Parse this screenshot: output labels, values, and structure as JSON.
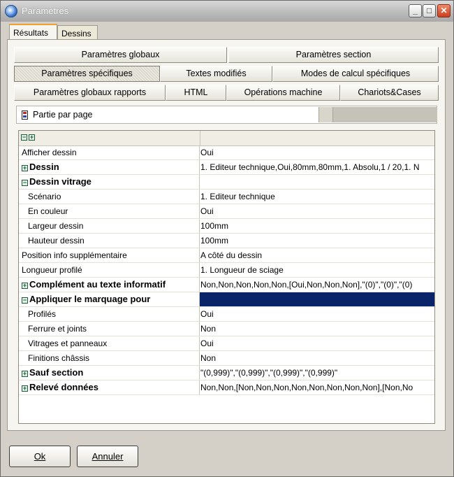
{
  "window": {
    "title": "Paramètres"
  },
  "outer_tabs": [
    {
      "label": "Résultats",
      "active": true
    },
    {
      "label": "Dessins",
      "active": false
    }
  ],
  "inner_tabs": {
    "row1": [
      "Paramètres globaux",
      "Paramètres section"
    ],
    "row2": [
      "Paramètres spécifiques",
      "Textes modifiés",
      "Modes de calcul spécifiques"
    ],
    "row3": [
      "Paramètres globaux rapports",
      "HTML",
      "Opérations machine",
      "Chariots&Cases"
    ],
    "selected": "Paramètres spécifiques"
  },
  "combo": {
    "value": "Partie par page"
  },
  "grid": {
    "rows": [
      {
        "name": "Afficher dessin",
        "value": "Oui",
        "level": 0,
        "bold": false,
        "toggle": ""
      },
      {
        "name": "Dessin",
        "value": "1. Editeur technique,Oui,80mm,80mm,1. Absolu,1 / 20,1. N",
        "level": 0,
        "bold": true,
        "toggle": "+"
      },
      {
        "name": "Dessin vitrage",
        "value": "",
        "level": 0,
        "bold": true,
        "toggle": "−"
      },
      {
        "name": "Scénario",
        "value": "1. Editeur technique",
        "level": 1,
        "bold": false,
        "toggle": ""
      },
      {
        "name": "En couleur",
        "value": "Oui",
        "level": 1,
        "bold": false,
        "toggle": ""
      },
      {
        "name": "Largeur dessin",
        "value": "100mm",
        "level": 1,
        "bold": false,
        "toggle": ""
      },
      {
        "name": "Hauteur dessin",
        "value": "100mm",
        "level": 1,
        "bold": false,
        "toggle": ""
      },
      {
        "name": "Position info supplémentaire",
        "value": "A côté du dessin",
        "level": 0,
        "bold": false,
        "toggle": ""
      },
      {
        "name": "Longueur profilé",
        "value": "1. Longueur de sciage",
        "level": 0,
        "bold": false,
        "toggle": ""
      },
      {
        "name": "Complément au texte informatif",
        "value": "Non,Non,Non,Non,Non,[Oui,Non,Non,Non],\"(0)\",\"(0)\",\"(0)",
        "level": 0,
        "bold": true,
        "toggle": "+"
      },
      {
        "name": "Appliquer le marquage pour",
        "value": "",
        "level": 0,
        "bold": true,
        "toggle": "−",
        "selected": true
      },
      {
        "name": "Profilés",
        "value": "Oui",
        "level": 1,
        "bold": false,
        "toggle": ""
      },
      {
        "name": "Ferrure et joints",
        "value": "Non",
        "level": 1,
        "bold": false,
        "toggle": ""
      },
      {
        "name": "Vitrages et panneaux",
        "value": "Oui",
        "level": 1,
        "bold": false,
        "toggle": ""
      },
      {
        "name": "Finitions châssis",
        "value": "Non",
        "level": 1,
        "bold": false,
        "toggle": ""
      },
      {
        "name": "Sauf section",
        "value": "\"(0,999)\",\"(0,999)\",\"(0,999)\",\"(0,999)\"",
        "level": 0,
        "bold": true,
        "toggle": "+"
      },
      {
        "name": "Relevé données",
        "value": "Non,Non,[Non,Non,Non,Non,Non,Non,Non,Non],[Non,No",
        "level": 0,
        "bold": true,
        "toggle": "+"
      }
    ]
  },
  "buttons": {
    "ok": "Ok",
    "cancel": "Annuler"
  },
  "colors": {
    "selection": "#0a246a",
    "tab_accent": "#f0a030"
  }
}
